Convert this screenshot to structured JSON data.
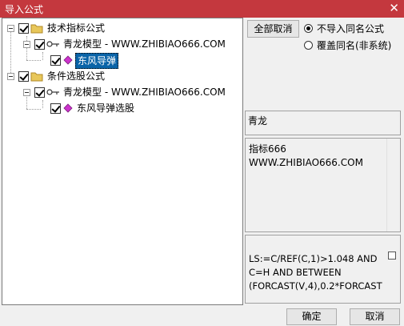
{
  "window": {
    "title": "导入公式",
    "close_glyph": "✕"
  },
  "tree": {
    "groups": [
      {
        "label": "技术指标公式",
        "model": "青龙模型 - WWW.ZHIBIAO666.COM",
        "formula": "东风导弹"
      },
      {
        "label": "条件选股公式",
        "model": "青龙模型 - WWW.ZHIBIAO666.COM",
        "formula": "东风导弹选股"
      }
    ]
  },
  "options": {
    "deselect_all_label": "全部取消",
    "radio_no_import_label": "不导入同名公式",
    "radio_overwrite_label": "覆盖同名(非系统)",
    "selected": "no_import"
  },
  "info": {
    "name": "青龙",
    "description_line1": "指标666",
    "description_line2": "WWW.ZHIBIAO666.COM",
    "code_line1": "LS:=C/REF(C,1)>1.048 AND",
    "code_line2": "C=H AND BETWEEN",
    "code_line3": "(FORCAST(V,4),0.2*FORCAST"
  },
  "footer": {
    "ok_label": "确定",
    "cancel_label": "取消"
  },
  "colors": {
    "titlebar": "#c4383e",
    "selection": "#0a64a8",
    "folder": "#e8c75a",
    "formula_icon": "#cc33cc"
  }
}
